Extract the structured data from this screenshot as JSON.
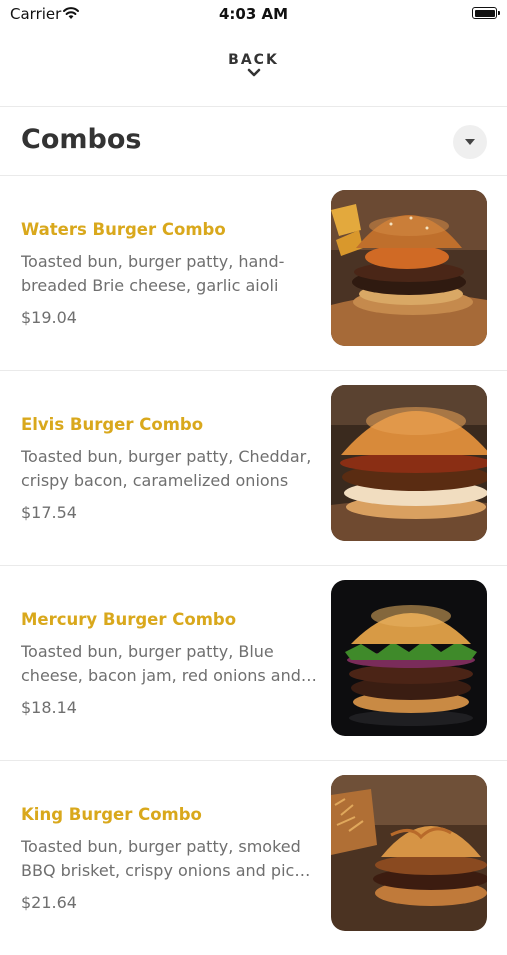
{
  "status_bar": {
    "carrier": "Carrier",
    "time": "4:03 AM"
  },
  "nav": {
    "back_label": "BACK"
  },
  "section": {
    "title": "Combos"
  },
  "items": [
    {
      "name": "Waters Burger Combo",
      "description": "Toasted bun, burger patty, hand-breaded Brie cheese, garlic aioli an…",
      "price": "$19.04"
    },
    {
      "name": "Elvis Burger Combo",
      "description": "Toasted bun, burger patty, Cheddar, crispy bacon, caramelized onions a…",
      "price": "$17.54"
    },
    {
      "name": "Mercury Burger Combo",
      "description": "Toasted bun, burger patty, Blue cheese, bacon jam, red onions and…",
      "price": "$18.14"
    },
    {
      "name": "King Burger Combo",
      "description": "Toasted bun, burger patty, smoked BBQ brisket, crispy onions and pic…",
      "price": "$21.64"
    }
  ],
  "colors": {
    "item_name": "#d9a81c",
    "text_secondary": "#6f6f6f",
    "title": "#333333"
  }
}
